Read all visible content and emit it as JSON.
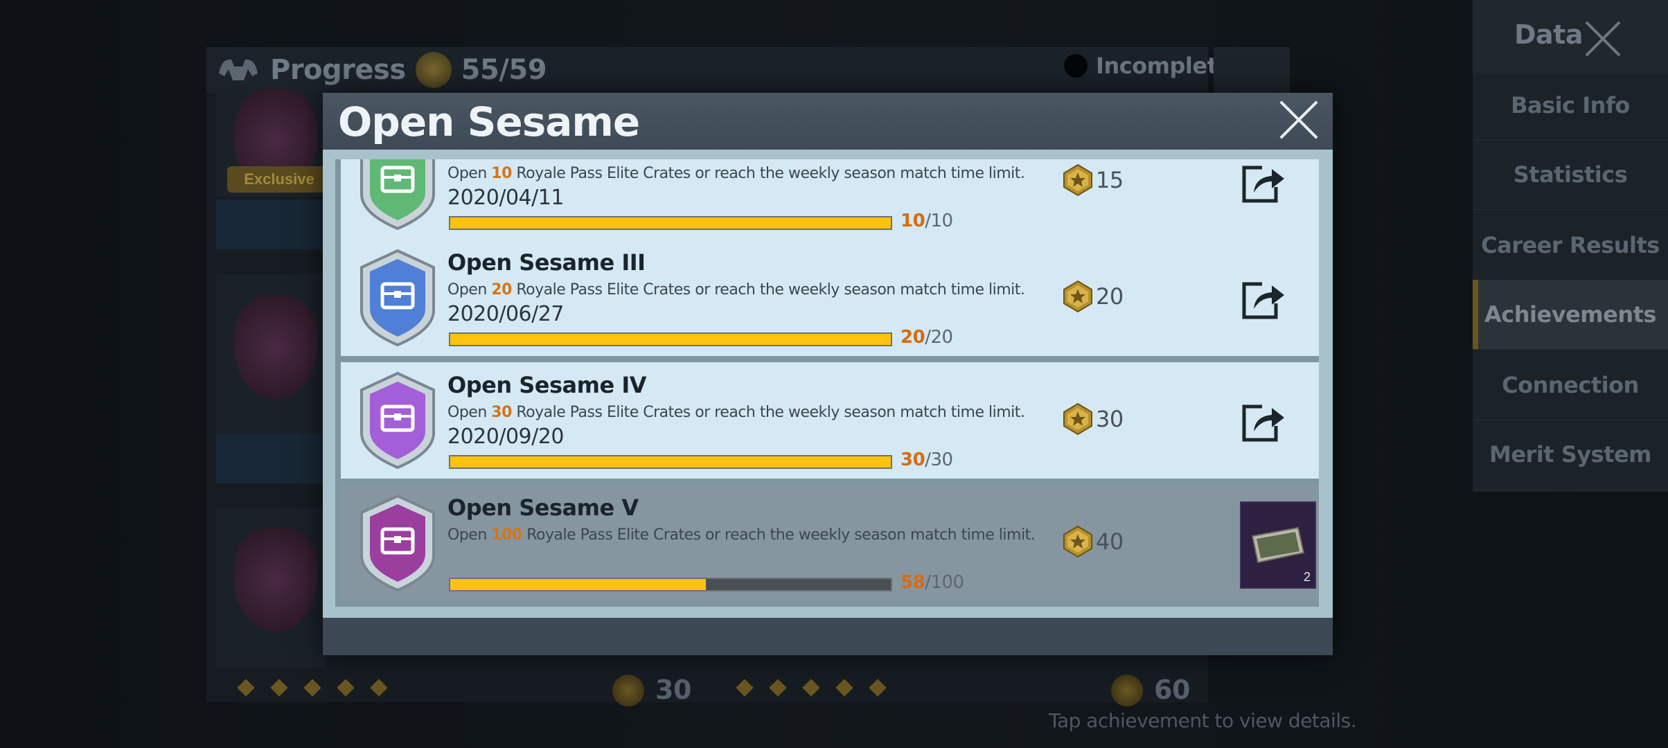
{
  "background": {
    "progress_label": "Progress",
    "progress_value": "55/59",
    "incomplete_label": "Incomplete",
    "exclusive_tag": "Exclusive",
    "card_scores": [
      "30",
      "60"
    ],
    "hint": "Tap achievement to view details."
  },
  "sidebar": {
    "title": "Data",
    "items": [
      {
        "label": "Basic Info"
      },
      {
        "label": "Statistics"
      },
      {
        "label": "Career Results"
      },
      {
        "label": "Achievements"
      },
      {
        "label": "Connection"
      },
      {
        "label": "Merit System"
      }
    ],
    "active_index": 3
  },
  "modal": {
    "title": "Open Sesame",
    "rows": [
      {
        "title": "",
        "desc_pre": "Open ",
        "desc_num": "10",
        "desc_post": " Royale Pass Elite Crates or reach the weekly season match time limit.",
        "date": "2020/04/11",
        "current": "10",
        "total": "/10",
        "progress": 1.0,
        "points": "15",
        "badge_color": "#5fb874",
        "state": "complete"
      },
      {
        "title": "Open Sesame III",
        "desc_pre": "Open ",
        "desc_num": "20",
        "desc_post": " Royale Pass Elite Crates or reach the weekly season match time limit.",
        "date": "2020/06/27",
        "current": "20",
        "total": "/20",
        "progress": 1.0,
        "points": "20",
        "badge_color": "#4f7fd6",
        "state": "complete"
      },
      {
        "title": "Open Sesame IV",
        "desc_pre": "Open ",
        "desc_num": "30",
        "desc_post": " Royale Pass Elite Crates or reach the weekly season match time limit.",
        "date": "2020/09/20",
        "current": "30",
        "total": "/30",
        "progress": 1.0,
        "points": "30",
        "badge_color": "#a25fd8",
        "state": "complete"
      },
      {
        "title": "Open Sesame V",
        "desc_pre": "Open ",
        "desc_num": "100",
        "desc_post": " Royale Pass Elite Crates or reach the weekly season match time limit.",
        "date": "",
        "current": "58",
        "total": "/100",
        "progress": 0.58,
        "points": "40",
        "badge_color": "#9a3f9e",
        "state": "incomplete",
        "reward_count": "2"
      }
    ]
  }
}
